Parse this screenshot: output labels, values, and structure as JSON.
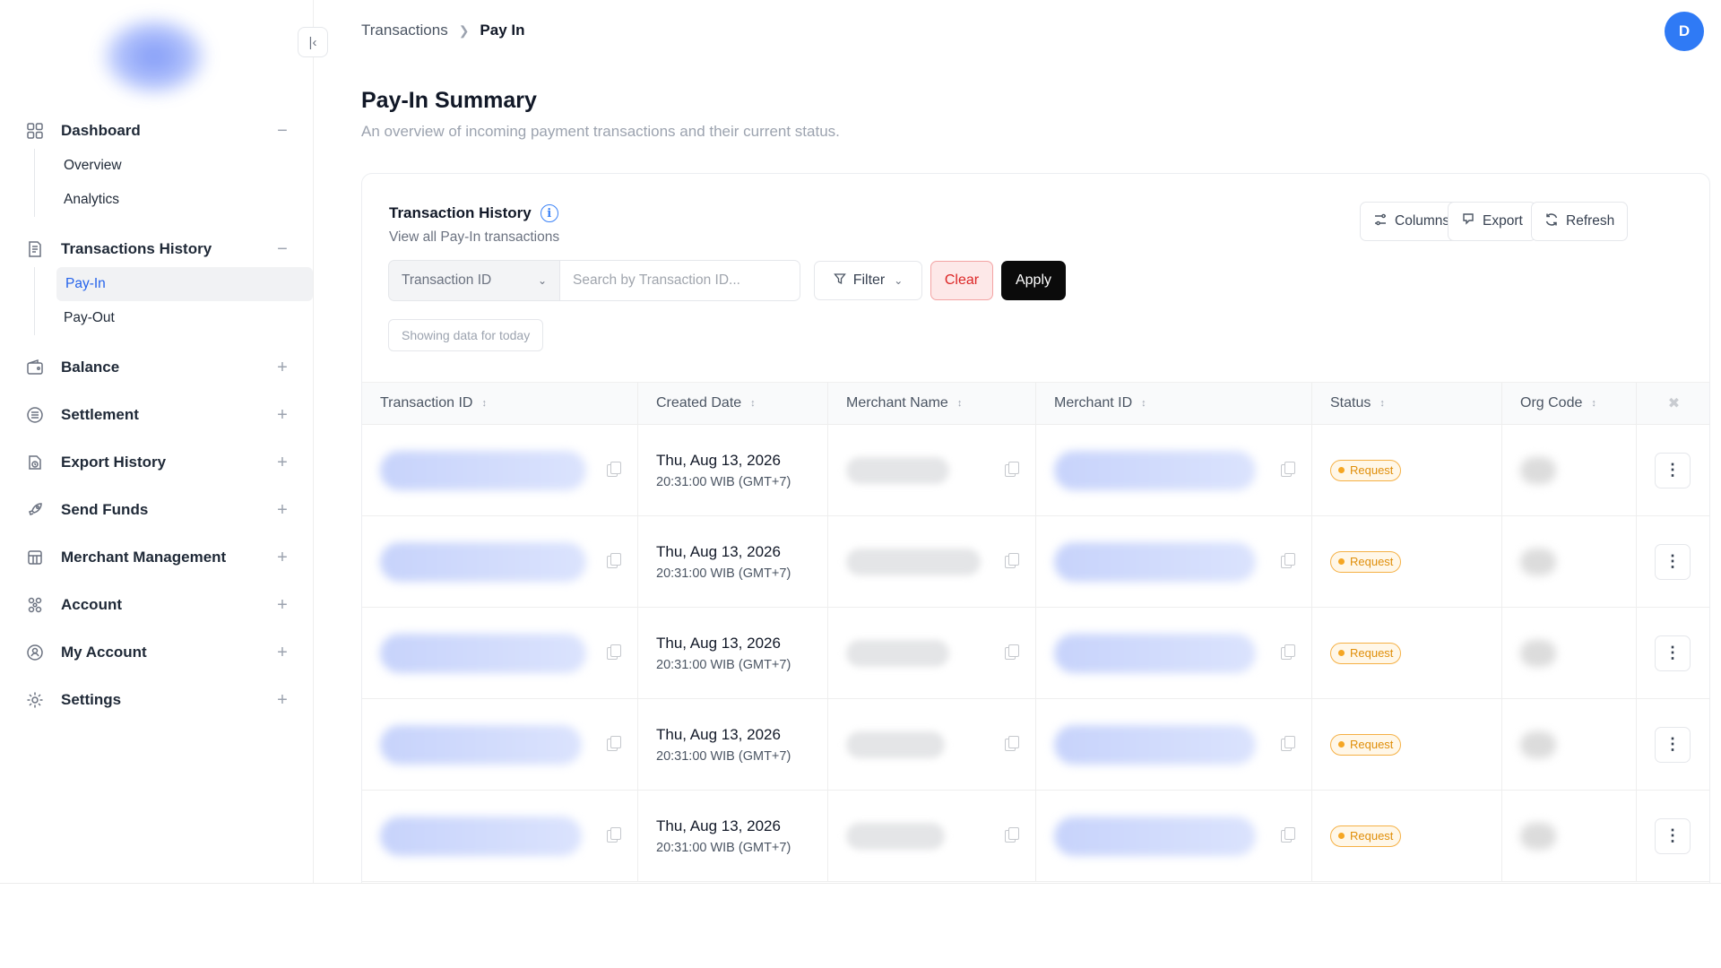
{
  "sidebar": {
    "collapse_icon": "collapse-left-icon",
    "items": [
      {
        "label": "Dashboard",
        "icon": "grid-icon",
        "toggle": "−",
        "expanded": true,
        "children": [
          "Overview",
          "Analytics"
        ]
      },
      {
        "label": "Transactions History",
        "icon": "receipt-icon",
        "toggle": "−",
        "expanded": true,
        "children": [
          "Pay-In",
          "Pay-Out"
        ],
        "active_child": "Pay-In"
      },
      {
        "label": "Balance",
        "icon": "wallet-icon",
        "toggle": "+"
      },
      {
        "label": "Settlement",
        "icon": "list-icon",
        "toggle": "+"
      },
      {
        "label": "Export History",
        "icon": "export-clock-icon",
        "toggle": "+"
      },
      {
        "label": "Send Funds",
        "icon": "rocket-icon",
        "toggle": "+"
      },
      {
        "label": "Merchant Management",
        "icon": "store-icon",
        "toggle": "+"
      },
      {
        "label": "Account",
        "icon": "nodes-icon",
        "toggle": "+"
      },
      {
        "label": "My Account",
        "icon": "user-shield-icon",
        "toggle": "+"
      },
      {
        "label": "Settings",
        "icon": "gear-icon",
        "toggle": "+"
      }
    ]
  },
  "header": {
    "breadcrumb": [
      "Transactions",
      "Pay In"
    ],
    "avatar_initial": "D"
  },
  "page": {
    "title": "Pay-In Summary",
    "subtitle": "An overview of incoming payment transactions and their current status."
  },
  "card": {
    "title": "Transaction History",
    "subtitle": "View all Pay-In transactions",
    "columns_label": "Columns",
    "export_label": "Export",
    "refresh_label": "Refresh",
    "filter": {
      "select_value": "Transaction ID",
      "search_placeholder": "Search by Transaction ID...",
      "filter_label": "Filter",
      "clear_label": "Clear",
      "apply_label": "Apply"
    },
    "showing_note": "Showing data for today"
  },
  "table": {
    "headers": [
      "Transaction ID",
      "Created Date",
      "Merchant Name",
      "Merchant ID",
      "Status",
      "Org Code"
    ],
    "rows": [
      {
        "date": "Thu, Aug 13, 2026",
        "time": "20:31:00 WIB (GMT+7)",
        "status": "Request"
      },
      {
        "date": "Thu, Aug 13, 2026",
        "time": "20:31:00 WIB (GMT+7)",
        "status": "Request"
      },
      {
        "date": "Thu, Aug 13, 2026",
        "time": "20:31:00 WIB (GMT+7)",
        "status": "Request"
      },
      {
        "date": "Thu, Aug 13, 2026",
        "time": "20:31:00 WIB (GMT+7)",
        "status": "Request"
      },
      {
        "date": "Thu, Aug 13, 2026",
        "time": "20:31:00 WIB (GMT+7)",
        "status": "Request"
      }
    ]
  },
  "colors": {
    "accent": "#2563eb",
    "avatar": "#2f7af5",
    "danger": "#dc2626",
    "warning": "#f5a623",
    "primary_button": "#0b0b0b"
  }
}
